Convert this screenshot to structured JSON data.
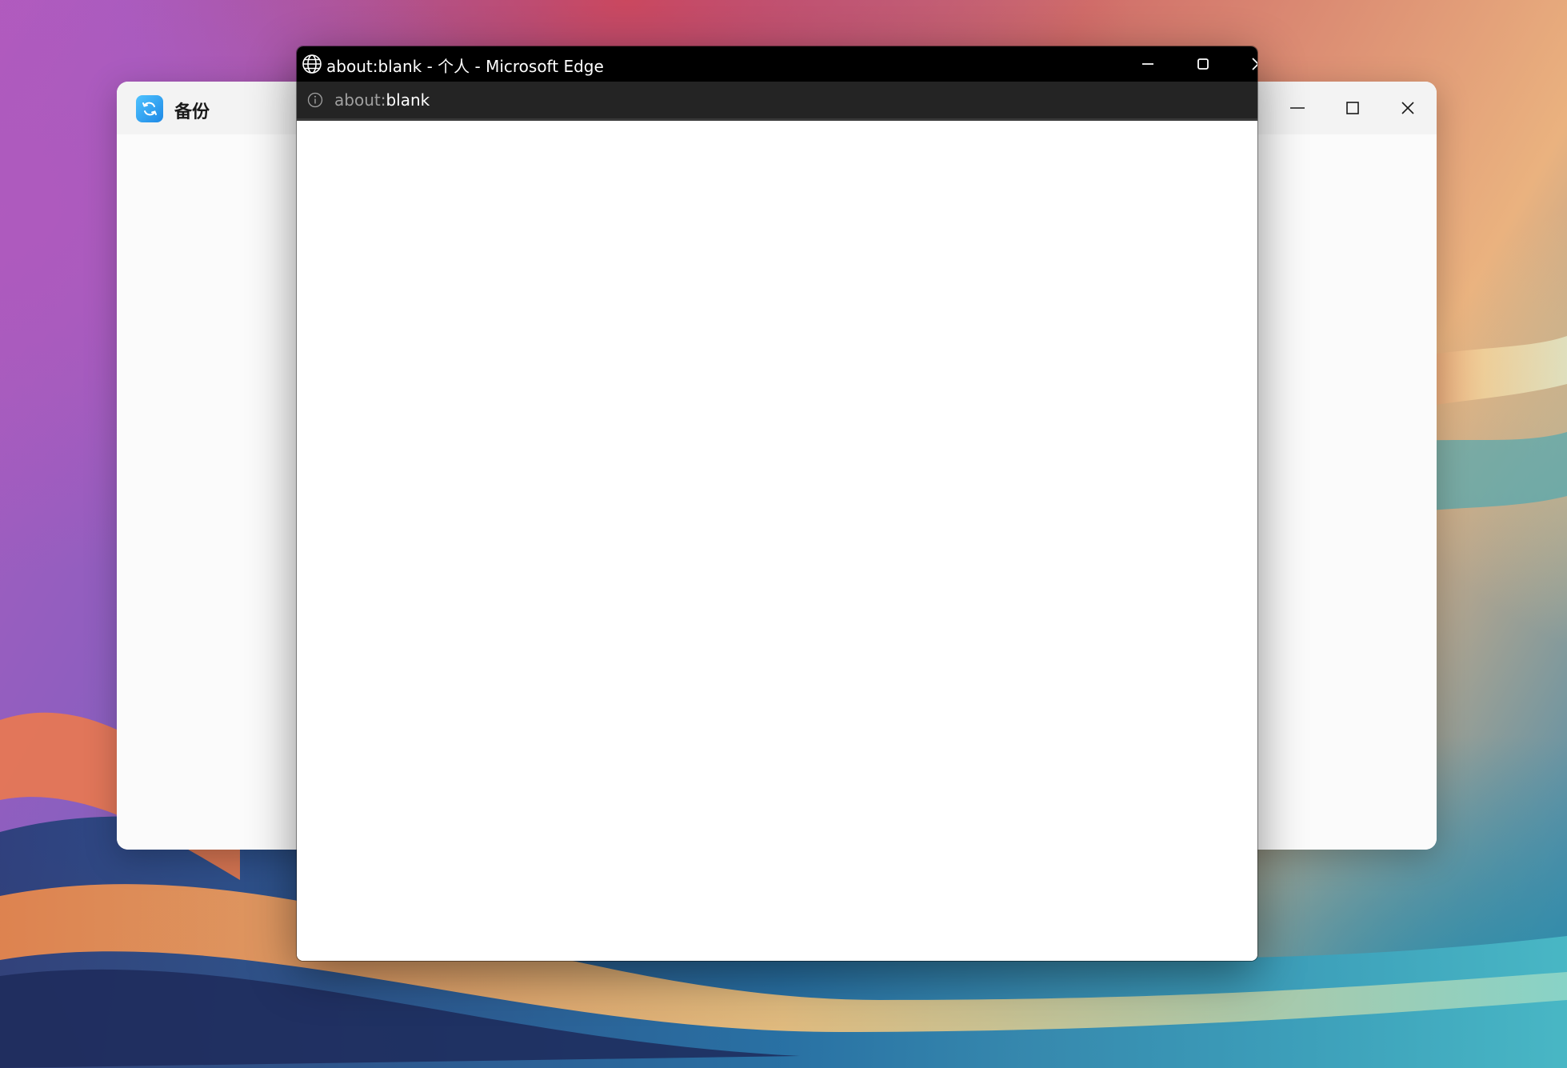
{
  "desktop": {
    "wallpaper": "abstract-waves-wallpaper"
  },
  "backup_window": {
    "title": "备份",
    "icon": "backup-sync-icon",
    "accent_color": "#1e88e5",
    "controls": {
      "minimize": "minimize-icon",
      "maximize": "maximize-icon",
      "close": "close-icon"
    }
  },
  "edge_window": {
    "title": "about:blank - 个人 - Microsoft Edge",
    "icon": "globe-icon",
    "address": {
      "scheme": "about:",
      "rest": "blank"
    },
    "controls": {
      "minimize": "minimize-icon",
      "maximize": "maximize-icon",
      "close": "close-icon"
    }
  }
}
